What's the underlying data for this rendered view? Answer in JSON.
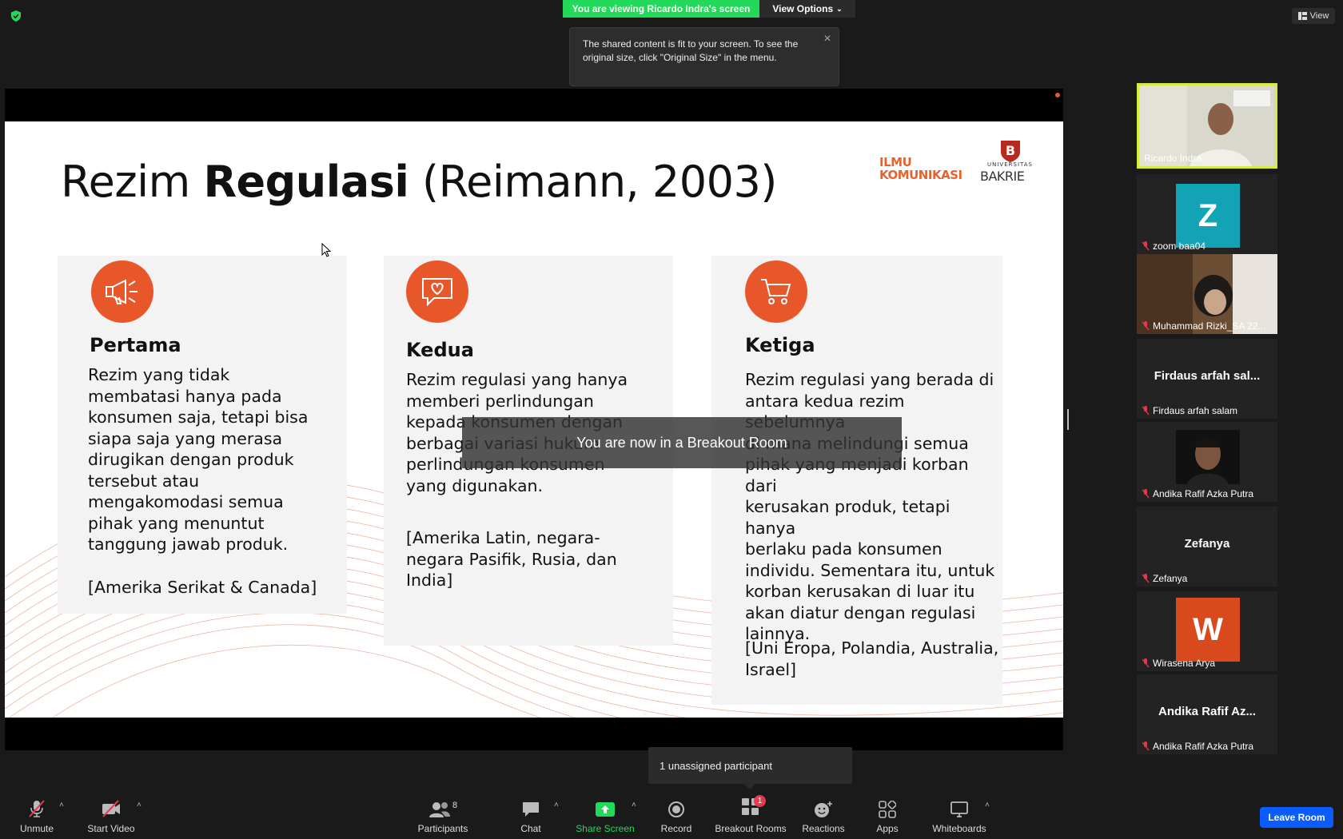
{
  "top": {
    "viewing_banner": "You are viewing Ricardo Indra's screen",
    "view_options": "View Options",
    "tooltip": "The shared content is fit to your screen. To see the original size, click \"Original Size\" in the menu.",
    "view_button": "View"
  },
  "slide": {
    "title_prefix": "Rezim ",
    "title_bold": "Regulasi",
    "title_suffix": " (Reimann, 2003)",
    "logo_line1": "ILMU",
    "logo_line2": "KOMUNIKASI",
    "logo_brand": "BAKRIE",
    "logo_univ": "UNIVERSITAS",
    "cards": [
      {
        "heading": "Pertama",
        "icon": "megaphone-icon",
        "body": "Rezim yang tidak\nmembatasi hanya pada\nkonsumen saja, tetapi bisa\nsiapa saja yang merasa\ndirugikan dengan produk\ntersebut atau\nmengakomodasi semua\npihak yang menuntut\ntanggung jawab produk.",
        "countries": "[Amerika Serikat & Canada]"
      },
      {
        "heading": "Kedua",
        "icon": "chat-heart-icon",
        "body": "Rezim regulasi yang hanya\nmemberi perlindungan\nkepada konsumen dengan\nberbagai variasi hukum\nperlindungan konsumen\nyang digunakan.",
        "countries": "[Amerika Latin, negara-\nnegara Pasifik, Rusia, dan\nIndia]"
      },
      {
        "heading": "Ketiga",
        "icon": "cart-icon",
        "body": "Rezim regulasi yang berada di\nantara kedua rezim sebelumnya\ndi mana melindungi semua\npihak yang menjadi korban dari\nkerusakan produk, tetapi hanya\nberlaku pada konsumen\nindividu. Sementara itu, untuk\nkorban kerusakan di luar itu\nakan diatur dengan regulasi\nlainnya.",
        "countries": "[Uni Eropa, Polandia, Australia,\nIsrael]"
      }
    ]
  },
  "breakout_toast": "You are now in a Breakout Room",
  "participants": [
    {
      "name": "Ricardo Indra",
      "type": "video",
      "active": true,
      "muted": false
    },
    {
      "name": "zoom baa04",
      "type": "letter",
      "letter": "Z",
      "color": "#12a4b4",
      "muted": true
    },
    {
      "name": "Muhammad Rizki_SA 22...",
      "type": "video",
      "muted": true
    },
    {
      "name": "Firdaus arfah salam",
      "type": "name",
      "display": "Firdaus arfah sal...",
      "muted": true
    },
    {
      "name": "Andika Rafif Azka Putra",
      "type": "video-small",
      "muted": true
    },
    {
      "name": "Zefanya",
      "type": "name",
      "display": "Zefanya",
      "muted": true
    },
    {
      "name": "Wirasena Arya",
      "type": "letter",
      "letter": "W",
      "color": "#d84a1e",
      "muted": true
    },
    {
      "name": "Andika Rafif Azka Putra",
      "type": "name",
      "display": "Andika Rafif Az...",
      "muted": true
    }
  ],
  "unassigned": "1 unassigned participant",
  "toolbar": {
    "unmute": "Unmute",
    "start_video": "Start Video",
    "participants": "Participants",
    "participants_count": "8",
    "chat": "Chat",
    "share_screen": "Share Screen",
    "record": "Record",
    "breakout_rooms": "Breakout Rooms",
    "breakout_badge": "1",
    "reactions": "Reactions",
    "apps": "Apps",
    "whiteboards": "Whiteboards",
    "leave_room": "Leave Room"
  },
  "colors": {
    "accent_orange": "#e8572a",
    "banner_green": "#23d959",
    "leave_blue": "#0b5cff",
    "active_border": "#d8ea3a"
  }
}
